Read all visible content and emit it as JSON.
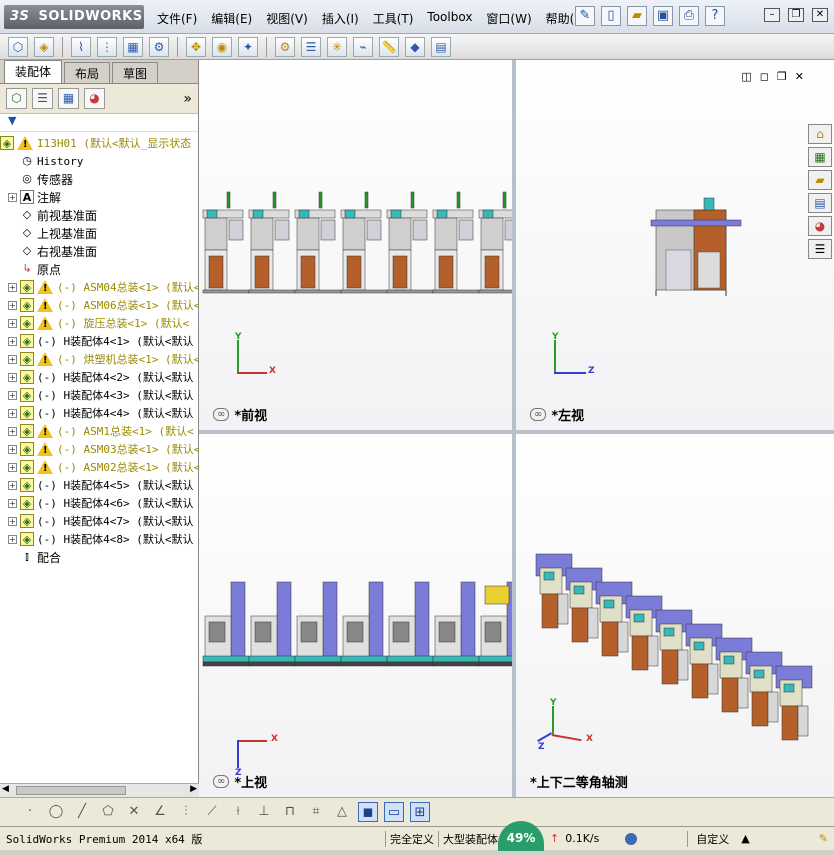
{
  "app": {
    "logo": "SOLIDWORKS",
    "logo_prefix": "3S"
  },
  "menu": [
    "文件(F)",
    "编辑(E)",
    "视图(V)",
    "插入(I)",
    "工具(T)",
    "Toolbox",
    "窗口(W)",
    "帮助(H)"
  ],
  "panel_tabs": [
    "装配体",
    "布局",
    "草图"
  ],
  "filter_icon": "funnel-icon",
  "tree": {
    "root": "I13H01  (默认<默认_显示状态",
    "items": [
      {
        "label": "History",
        "icon": "history-icon",
        "style": "mono",
        "expand": false
      },
      {
        "label": "传感器",
        "icon": "sensor-icon",
        "style": "",
        "expand": false
      },
      {
        "label": "注解",
        "icon": "annotation-icon",
        "style": "",
        "expand": true
      },
      {
        "label": "前视基准面",
        "icon": "plane-icon",
        "style": "",
        "expand": false
      },
      {
        "label": "上视基准面",
        "icon": "plane-icon",
        "style": "",
        "expand": false
      },
      {
        "label": "右视基准面",
        "icon": "plane-icon",
        "style": "",
        "expand": false
      },
      {
        "label": "原点",
        "icon": "origin-icon",
        "style": "",
        "expand": false
      },
      {
        "label": "(-) ASM04总装<1> (默认<",
        "icon": "assembly-icon",
        "style": "yel",
        "warn": true,
        "expand": true
      },
      {
        "label": "(-) ASM06总装<1> (默认<",
        "icon": "assembly-icon",
        "style": "yel",
        "warn": true,
        "expand": true
      },
      {
        "label": "(-) 旋压总装<1> (默认<",
        "icon": "assembly-icon",
        "style": "yel",
        "warn": true,
        "expand": true
      },
      {
        "label": "(-) H装配体4<1> (默认<默认",
        "icon": "assembly-icon",
        "style": "",
        "warn": false,
        "expand": true
      },
      {
        "label": "(-) 烘塑机总装<1> (默认<",
        "icon": "assembly-icon",
        "style": "yel",
        "warn": true,
        "expand": true
      },
      {
        "label": "(-) H装配体4<2> (默认<默认",
        "icon": "assembly-icon",
        "style": "",
        "warn": false,
        "expand": true
      },
      {
        "label": "(-) H装配体4<3> (默认<默认",
        "icon": "assembly-icon",
        "style": "",
        "warn": false,
        "expand": true
      },
      {
        "label": "(-) H装配体4<4> (默认<默认",
        "icon": "assembly-icon",
        "style": "",
        "warn": false,
        "expand": true
      },
      {
        "label": "(-) ASM1总装<1> (默认<",
        "icon": "assembly-icon",
        "style": "yel",
        "warn": true,
        "expand": true
      },
      {
        "label": "(-) ASM03总装<1> (默认<",
        "icon": "assembly-icon",
        "style": "yel",
        "warn": true,
        "expand": true
      },
      {
        "label": "(-) ASM02总装<1> (默认<",
        "icon": "assembly-icon",
        "style": "yel",
        "warn": true,
        "expand": true
      },
      {
        "label": "(-) H装配体4<5> (默认<默认",
        "icon": "assembly-icon",
        "style": "",
        "warn": false,
        "expand": true
      },
      {
        "label": "(-) H装配体4<6> (默认<默认",
        "icon": "assembly-icon",
        "style": "",
        "warn": false,
        "expand": true
      },
      {
        "label": "(-) H装配体4<7> (默认<默认",
        "icon": "assembly-icon",
        "style": "",
        "warn": false,
        "expand": true
      },
      {
        "label": "(-) H装配体4<8> (默认<默认",
        "icon": "assembly-icon",
        "style": "",
        "warn": false,
        "expand": true
      },
      {
        "label": "配合",
        "icon": "mates-icon",
        "style": "",
        "expand": false
      }
    ]
  },
  "views": {
    "front": "*前视",
    "left": "*左视",
    "top": "*上视",
    "iso": "*上下二等角轴测"
  },
  "status": {
    "product": "SolidWorks Premium 2014 x64 版",
    "state1": "完全定义",
    "state2": "大型装配体",
    "net": "0.1K/s",
    "percent": "49%",
    "custom": "自定义"
  },
  "colors": {
    "accent": "#2b5aa8",
    "warn": "#f3c21a",
    "machine_wood": "#b5602a",
    "machine_blue": "#7b7bd8",
    "machine_teal": "#38b8b8"
  }
}
